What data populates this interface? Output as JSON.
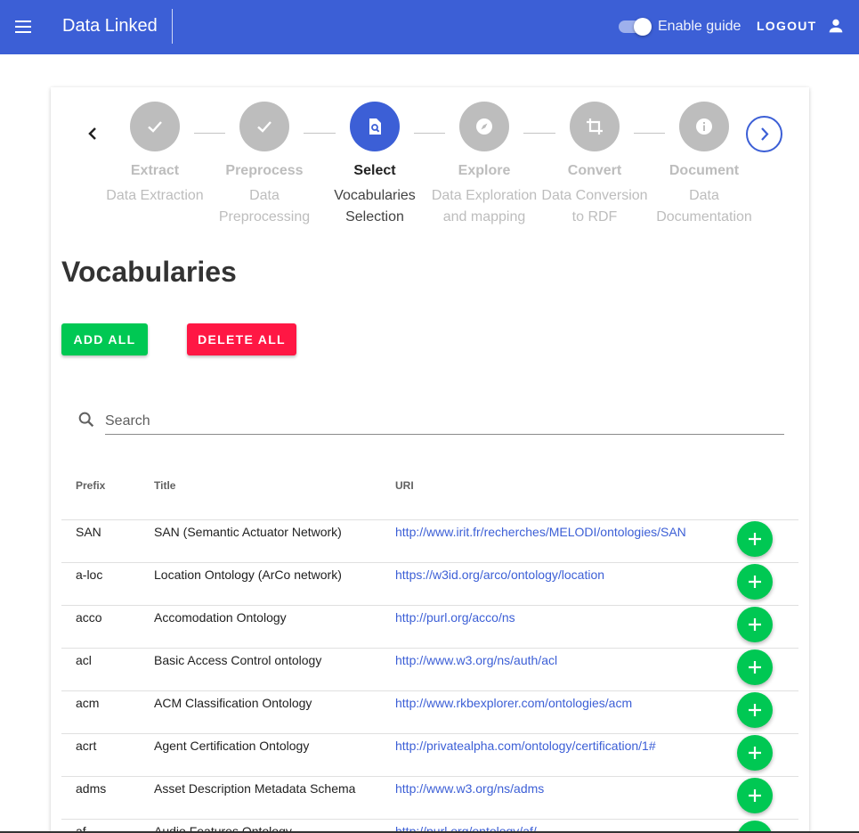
{
  "app": {
    "title": "Data Linked",
    "guide_label": "Enable guide",
    "guide_enabled": true,
    "logout_label": "LOGOUT",
    "icons": {
      "menu": "menu-icon",
      "account": "person-icon"
    },
    "colors": {
      "primary": "#3c5fd6",
      "success": "#00c853",
      "danger": "#ff1744",
      "inactive": "#bdbdbd"
    }
  },
  "stepper": {
    "steps": [
      {
        "name": "Extract",
        "desc1": "Data Extraction",
        "desc2": "",
        "state": "done",
        "icon": "check-icon"
      },
      {
        "name": "Preprocess",
        "desc1": "Data",
        "desc2": "Preprocessing",
        "state": "done",
        "icon": "check-icon"
      },
      {
        "name": "Select",
        "desc1": "Vocabularies",
        "desc2": "Selection",
        "state": "active",
        "icon": "document-search-icon"
      },
      {
        "name": "Explore",
        "desc1": "Data Exploration",
        "desc2": "and mapping",
        "state": "pending",
        "icon": "compass-icon"
      },
      {
        "name": "Convert",
        "desc1": "Data Conversion",
        "desc2": "to RDF",
        "state": "pending",
        "icon": "crop-icon"
      },
      {
        "name": "Document",
        "desc1": "Data",
        "desc2": "Documentation",
        "state": "pending",
        "icon": "info-icon"
      }
    ]
  },
  "page": {
    "heading": "Vocabularies",
    "add_all_label": "ADD ALL",
    "delete_all_label": "DELETE ALL",
    "search": {
      "placeholder": "Search",
      "value": ""
    }
  },
  "table": {
    "columns": [
      "Prefix",
      "Title",
      "URI"
    ],
    "rows": [
      {
        "prefix": "SAN",
        "title": "SAN (Semantic Actuator Network)",
        "uri": "http://www.irit.fr/recherches/MELODI/ontologies/SAN"
      },
      {
        "prefix": "a-loc",
        "title": "Location Ontology (ArCo network)",
        "uri": "https://w3id.org/arco/ontology/location"
      },
      {
        "prefix": "acco",
        "title": "Accomodation Ontology",
        "uri": "http://purl.org/acco/ns"
      },
      {
        "prefix": "acl",
        "title": "Basic Access Control ontology",
        "uri": "http://www.w3.org/ns/auth/acl"
      },
      {
        "prefix": "acm",
        "title": "ACM Classification Ontology",
        "uri": "http://www.rkbexplorer.com/ontologies/acm"
      },
      {
        "prefix": "acrt",
        "title": "Agent Certification Ontology",
        "uri": "http://privatealpha.com/ontology/certification/1#"
      },
      {
        "prefix": "adms",
        "title": "Asset Description Metadata Schema",
        "uri": "http://www.w3.org/ns/adms"
      },
      {
        "prefix": "af",
        "title": "Audio Features Ontology",
        "uri": "http://purl.org/ontology/af/"
      }
    ]
  }
}
